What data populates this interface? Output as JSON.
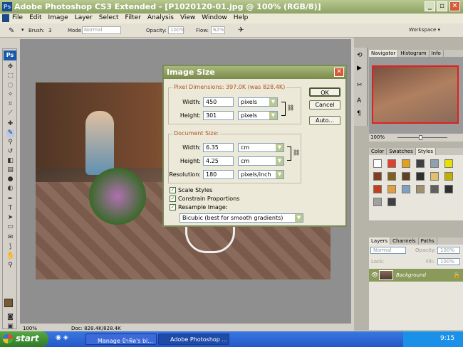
{
  "window": {
    "title": "Adobe Photoshop CS3 Extended - [P1020120-01.jpg @ 100% (RGB/8)]",
    "logo": "Ps"
  },
  "menu": [
    "File",
    "Edit",
    "Image",
    "Layer",
    "Select",
    "Filter",
    "Analysis",
    "View",
    "Window",
    "Help"
  ],
  "options": {
    "brush_label": "Brush:",
    "brush_size": "3",
    "mode_label": "Mode:",
    "mode_value": "Normal",
    "opacity_label": "Opacity:",
    "opacity_value": "100%",
    "flow_label": "Flow:",
    "flow_value": "62%",
    "workspace_label": "Workspace ▾"
  },
  "statusbar": {
    "zoom": "100%",
    "doc": "Doc: 828.4K/828.4K"
  },
  "dialog": {
    "title": "Image Size",
    "pixel_dimensions": "Pixel Dimensions:  397.0K (was 828.4K)",
    "px_width_label": "Width:",
    "px_width_value": "450",
    "px_width_unit": "pixels",
    "px_height_label": "Height:",
    "px_height_value": "301",
    "px_height_unit": "pixels",
    "document_size": "Document Size:",
    "doc_width_label": "Width:",
    "doc_width_value": "6.35",
    "doc_width_unit": "cm",
    "doc_height_label": "Height:",
    "doc_height_value": "4.25",
    "doc_height_unit": "cm",
    "resolution_label": "Resolution:",
    "resolution_value": "180",
    "resolution_unit": "pixels/inch",
    "scale_styles": "Scale Styles",
    "constrain": "Constrain Proportions",
    "resample": "Resample Image:",
    "resample_method": "Bicubic (best for smooth gradients)",
    "ok": "OK",
    "cancel": "Cancel",
    "auto": "Auto..."
  },
  "panels": {
    "navigator_tabs": [
      "Navigator",
      "Histogram",
      "Info"
    ],
    "nav_zoom": "100%",
    "color_tabs": [
      "Color",
      "Swatches",
      "Styles"
    ],
    "layers_tabs": [
      "Layers",
      "Channels",
      "Paths"
    ],
    "layers_mode": "Normal",
    "layers_opacity_label": "Opacity:",
    "layers_opacity": "100%",
    "lock_label": "Lock:",
    "fill_label": "Fill:",
    "fill_value": "100%",
    "layer_name": "Background"
  },
  "taskbar": {
    "start": "start",
    "task1": "Manage ป้าพิล's bl...",
    "task2": "Adobe Photoshop ...",
    "time": "9:15"
  },
  "swatch_colors": [
    "#ffffff",
    "#e04030",
    "#e0a020",
    "#404040",
    "#90a0b0",
    "#e8e000",
    "#804020",
    "#806020",
    "#604020",
    "#303030",
    "#e0c070",
    "#c0b000",
    "#c04020",
    "#e0a040",
    "#80a0c0",
    "#a09070",
    "#606060",
    "#303030",
    "#a0a0a0",
    "#404040"
  ]
}
